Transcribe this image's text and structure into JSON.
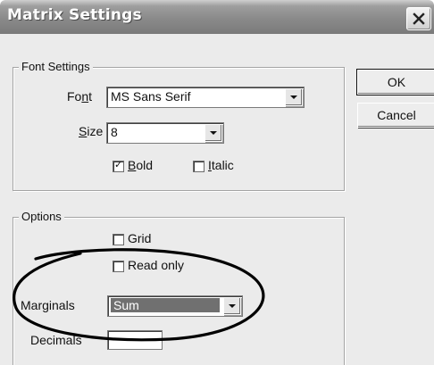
{
  "window": {
    "title": "Matrix Settings"
  },
  "buttons": {
    "ok_label": "OK",
    "cancel_label": "Cancel"
  },
  "font_settings": {
    "group_label": "Font Settings",
    "font_label_pre": "Fo",
    "font_label_ul": "n",
    "font_label_post": "t",
    "font_value": "MS Sans Serif",
    "size_label_ul": "S",
    "size_label_post": "ize",
    "size_value": "8",
    "bold_label_ul": "B",
    "bold_label_post": "old",
    "bold_checked": true,
    "italic_label_ul": "I",
    "italic_label_post": "talic",
    "italic_checked": false
  },
  "options": {
    "group_label": "Options",
    "grid_label": "Grid",
    "grid_checked": false,
    "readonly_label": "Read only",
    "readonly_checked": false,
    "marginals_label": "Marginals",
    "marginals_value": "Sum",
    "decimals_label": "Decimals",
    "decimals_value": ""
  },
  "annotation": {
    "shape": "ellipse",
    "color": "#000000"
  }
}
